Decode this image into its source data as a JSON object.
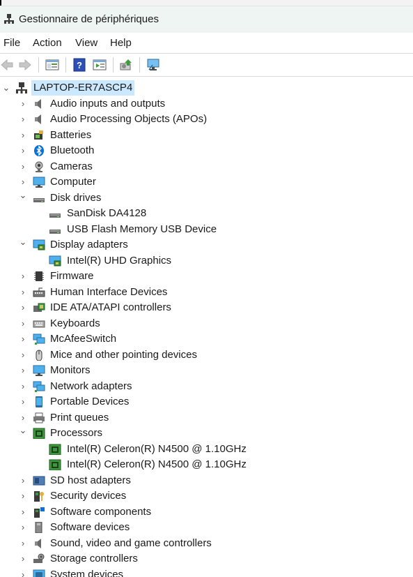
{
  "window": {
    "title": "Gestionnaire de périphériques"
  },
  "menu": {
    "file": "File",
    "action": "Action",
    "view": "View",
    "help": "Help"
  },
  "toolbar": {
    "buttons": [
      {
        "name": "back-arrow-icon",
        "enabled": false
      },
      {
        "name": "forward-arrow-icon",
        "enabled": false
      },
      {
        "name": "properties-icon",
        "enabled": true
      },
      {
        "name": "help-icon",
        "enabled": true
      },
      {
        "name": "update-driver-icon",
        "enabled": true
      },
      {
        "name": "scan-hardware-icon",
        "enabled": true
      },
      {
        "name": "monitor-view-icon",
        "enabled": true
      }
    ]
  },
  "tree": {
    "root": {
      "label": "LAPTOP-ER7ASCP4",
      "expanded": true
    },
    "items": [
      {
        "label": "Audio inputs and outputs",
        "icon": "speaker-icon",
        "level": 1,
        "state": "collapsed"
      },
      {
        "label": "Audio Processing Objects (APOs)",
        "icon": "speaker-icon",
        "level": 1,
        "state": "collapsed"
      },
      {
        "label": "Batteries",
        "icon": "battery-icon",
        "level": 1,
        "state": "collapsed"
      },
      {
        "label": "Bluetooth",
        "icon": "bluetooth-icon",
        "level": 1,
        "state": "collapsed"
      },
      {
        "label": "Cameras",
        "icon": "camera-icon",
        "level": 1,
        "state": "collapsed"
      },
      {
        "label": "Computer",
        "icon": "monitor-icon",
        "level": 1,
        "state": "collapsed"
      },
      {
        "label": "Disk drives",
        "icon": "disk-drive-icon",
        "level": 1,
        "state": "expanded"
      },
      {
        "label": "SanDisk DA4128",
        "icon": "disk-drive-icon",
        "level": 2,
        "state": "leaf"
      },
      {
        "label": "USB Flash Memory USB Device",
        "icon": "disk-drive-icon",
        "level": 2,
        "state": "leaf"
      },
      {
        "label": "Display adapters",
        "icon": "display-adapter-icon",
        "level": 1,
        "state": "expanded"
      },
      {
        "label": "Intel(R) UHD Graphics",
        "icon": "display-adapter-icon",
        "level": 2,
        "state": "leaf"
      },
      {
        "label": "Firmware",
        "icon": "firmware-icon",
        "level": 1,
        "state": "collapsed"
      },
      {
        "label": "Human Interface Devices",
        "icon": "hid-icon",
        "level": 1,
        "state": "collapsed"
      },
      {
        "label": "IDE ATA/ATAPI controllers",
        "icon": "ide-controller-icon",
        "level": 1,
        "state": "collapsed"
      },
      {
        "label": "Keyboards",
        "icon": "keyboard-icon",
        "level": 1,
        "state": "collapsed"
      },
      {
        "label": "McAfeeSwitch",
        "icon": "network-icon",
        "level": 1,
        "state": "collapsed"
      },
      {
        "label": "Mice and other pointing devices",
        "icon": "mouse-icon",
        "level": 1,
        "state": "collapsed"
      },
      {
        "label": "Monitors",
        "icon": "monitor-icon",
        "level": 1,
        "state": "collapsed"
      },
      {
        "label": "Network adapters",
        "icon": "network-icon",
        "level": 1,
        "state": "collapsed"
      },
      {
        "label": "Portable Devices",
        "icon": "portable-device-icon",
        "level": 1,
        "state": "collapsed"
      },
      {
        "label": "Print queues",
        "icon": "printer-icon",
        "level": 1,
        "state": "collapsed"
      },
      {
        "label": "Processors",
        "icon": "processor-icon",
        "level": 1,
        "state": "expanded"
      },
      {
        "label": "Intel(R) Celeron(R) N4500 @ 1.10GHz",
        "icon": "processor-icon",
        "level": 2,
        "state": "leaf"
      },
      {
        "label": "Intel(R) Celeron(R) N4500 @ 1.10GHz",
        "icon": "processor-icon",
        "level": 2,
        "state": "leaf"
      },
      {
        "label": "SD host adapters",
        "icon": "sd-adapter-icon",
        "level": 1,
        "state": "collapsed"
      },
      {
        "label": "Security devices",
        "icon": "security-device-icon",
        "level": 1,
        "state": "collapsed"
      },
      {
        "label": "Software components",
        "icon": "software-component-icon",
        "level": 1,
        "state": "collapsed"
      },
      {
        "label": "Software devices",
        "icon": "software-device-icon",
        "level": 1,
        "state": "collapsed"
      },
      {
        "label": "Sound, video and game controllers",
        "icon": "speaker-icon",
        "level": 1,
        "state": "collapsed"
      },
      {
        "label": "Storage controllers",
        "icon": "storage-controller-icon",
        "level": 1,
        "state": "collapsed"
      },
      {
        "label": "System devices",
        "icon": "system-device-icon",
        "level": 1,
        "state": "collapsed"
      }
    ]
  },
  "colors": {
    "selection": "#cce8ff",
    "titlebar": "#eef5f3",
    "accent": "#0078d4"
  }
}
